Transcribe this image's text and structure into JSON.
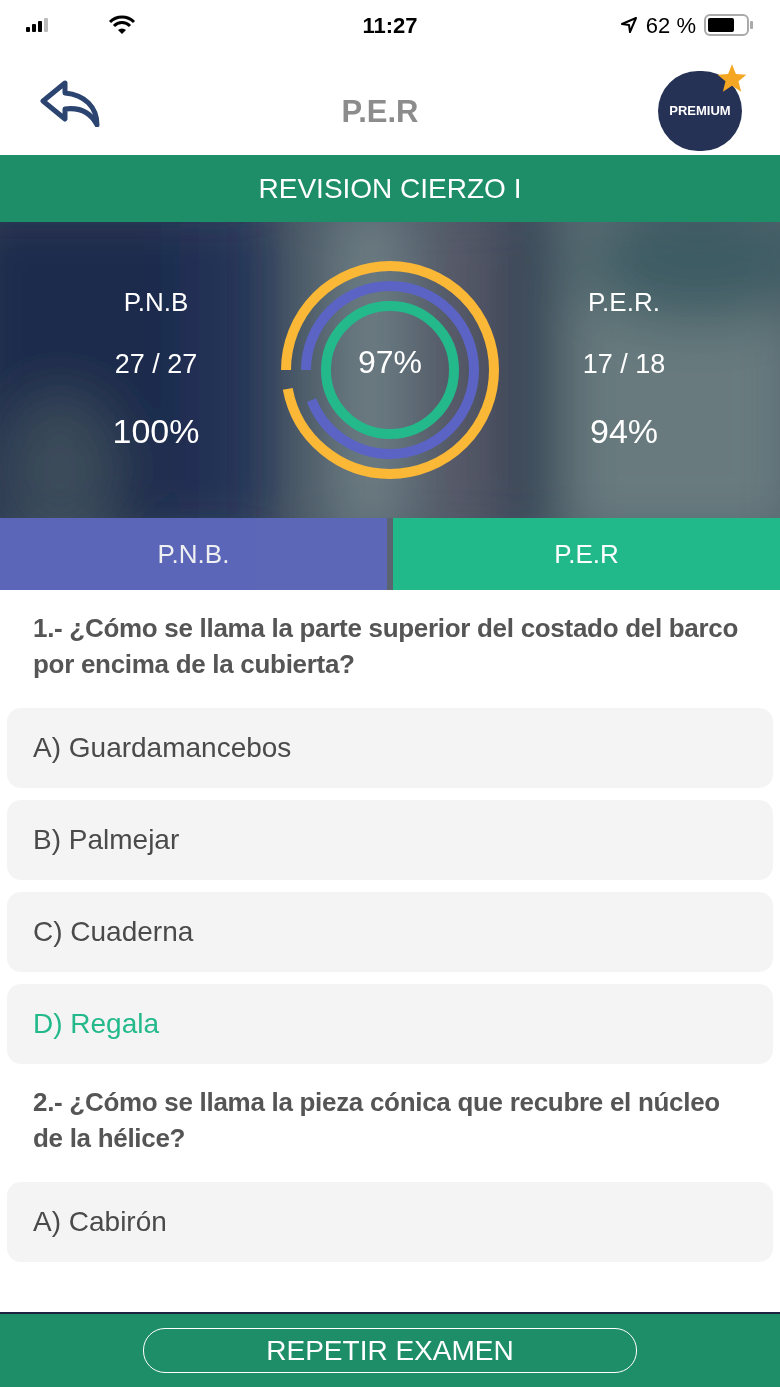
{
  "status_bar": {
    "time": "11:27",
    "battery": "62 %"
  },
  "header": {
    "title": "P.E.R",
    "premium_badge": "PREMIUM"
  },
  "exam_title": "REVISION CIERZO I",
  "stats": {
    "left": {
      "label": "P.N.B",
      "score": "27 / 27",
      "percent": "100%",
      "level": 1
    },
    "right": {
      "label": "P.E.R.",
      "score": "17 / 18",
      "percent": "94%",
      "level": 0.94
    },
    "total": {
      "percent": "97%",
      "level": 0.97
    }
  },
  "tabs": [
    {
      "label": "P.N.B.",
      "selected": false,
      "color": "#5c67c0"
    },
    {
      "label": "P.E.R",
      "selected": true,
      "color": "#22b98a"
    }
  ],
  "questions": [
    {
      "text": "1.- ¿Cómo se llama la parte superior del costado del barco por encima de la cubierta?",
      "answers": [
        {
          "text": "A) Guardamancebos",
          "correct": false
        },
        {
          "text": "B) Palmejar",
          "correct": false
        },
        {
          "text": "C) Cuaderna",
          "correct": false
        },
        {
          "text": "D) Regala",
          "correct": true
        }
      ]
    },
    {
      "text": "2.- ¿Cómo se llama la pieza cónica que recubre el núcleo de la hélice?",
      "answers": [
        {
          "text": "A) Cabirón",
          "correct": false
        }
      ]
    }
  ],
  "footer_button": "REPETIR EXAMEN"
}
